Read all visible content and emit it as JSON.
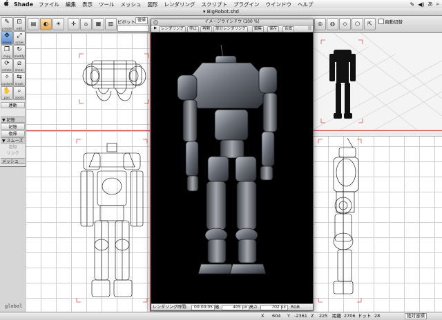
{
  "menubar": {
    "apple": "",
    "app_name": "Shade",
    "items": [
      "ファイル",
      "編集",
      "表示",
      "ツール",
      "メッシュ",
      "図形",
      "レンダリング",
      "スクリプト",
      "プラグイン",
      "ウインドウ",
      "ヘルプ"
    ]
  },
  "window": {
    "title": "BigRobot.shd"
  },
  "toolbar": {
    "pivot_label": "ピボット",
    "pivot_value": "復帰",
    "auto_switch_label": "自動切替"
  },
  "toolbox": {
    "tools": [
      {
        "name": "create",
        "icon": "✎"
      },
      {
        "name": "edit",
        "icon": "⊡"
      },
      {
        "name": "move",
        "icon": "✥"
      },
      {
        "name": "scale",
        "icon": "⤢"
      },
      {
        "name": "copy",
        "icon": "❐"
      },
      {
        "name": "modify",
        "icon": "↻"
      },
      {
        "name": "rotate",
        "icon": "⟳"
      },
      {
        "name": "shear",
        "icon": "⧄"
      },
      {
        "name": "custom",
        "icon": "✧"
      },
      {
        "name": "track",
        "icon": "⇆"
      },
      {
        "name": "pan",
        "icon": "✋"
      },
      {
        "name": "zoom",
        "icon": "⌕"
      }
    ],
    "section_link": "連動",
    "section_record": "▼ 記憶",
    "btn_record": "記憶",
    "btn_restore": "復帰",
    "section_smooth": "▼ スムーズ",
    "btn_add": "追加",
    "btn_link": "リンク",
    "section_mesh": "メッシュ"
  },
  "image_window": {
    "title": "イメージウインドウ (100 %)",
    "buttons": {
      "render": "レンダリング",
      "stop": "停止",
      "redo": "再開",
      "partial": "部分レンダリング",
      "edit": "編集",
      "save": "保存",
      "composite": "合成"
    },
    "status": {
      "time_label": "レンダリング時間:",
      "time_value": "00:00:05",
      "width_label": "幅",
      "width_value": "405 px",
      "height_label": "高さ",
      "height_value": "702 px",
      "mode": "RGB"
    }
  },
  "viewports": {
    "label": "global"
  },
  "statusbar": {
    "x_label": "X",
    "x_value": "604",
    "y_label": "Y",
    "y_value": "-2361",
    "z_label": "Z",
    "z_value": "225",
    "d_label": "距離",
    "d_value": "2706",
    "unit_label": "ドット",
    "unit_value": "28",
    "coord_mode": "絶対座標"
  },
  "colors": {
    "accent": "#5d8fd1",
    "guide_red": "#e04a4a",
    "render_bg": "#000000"
  }
}
